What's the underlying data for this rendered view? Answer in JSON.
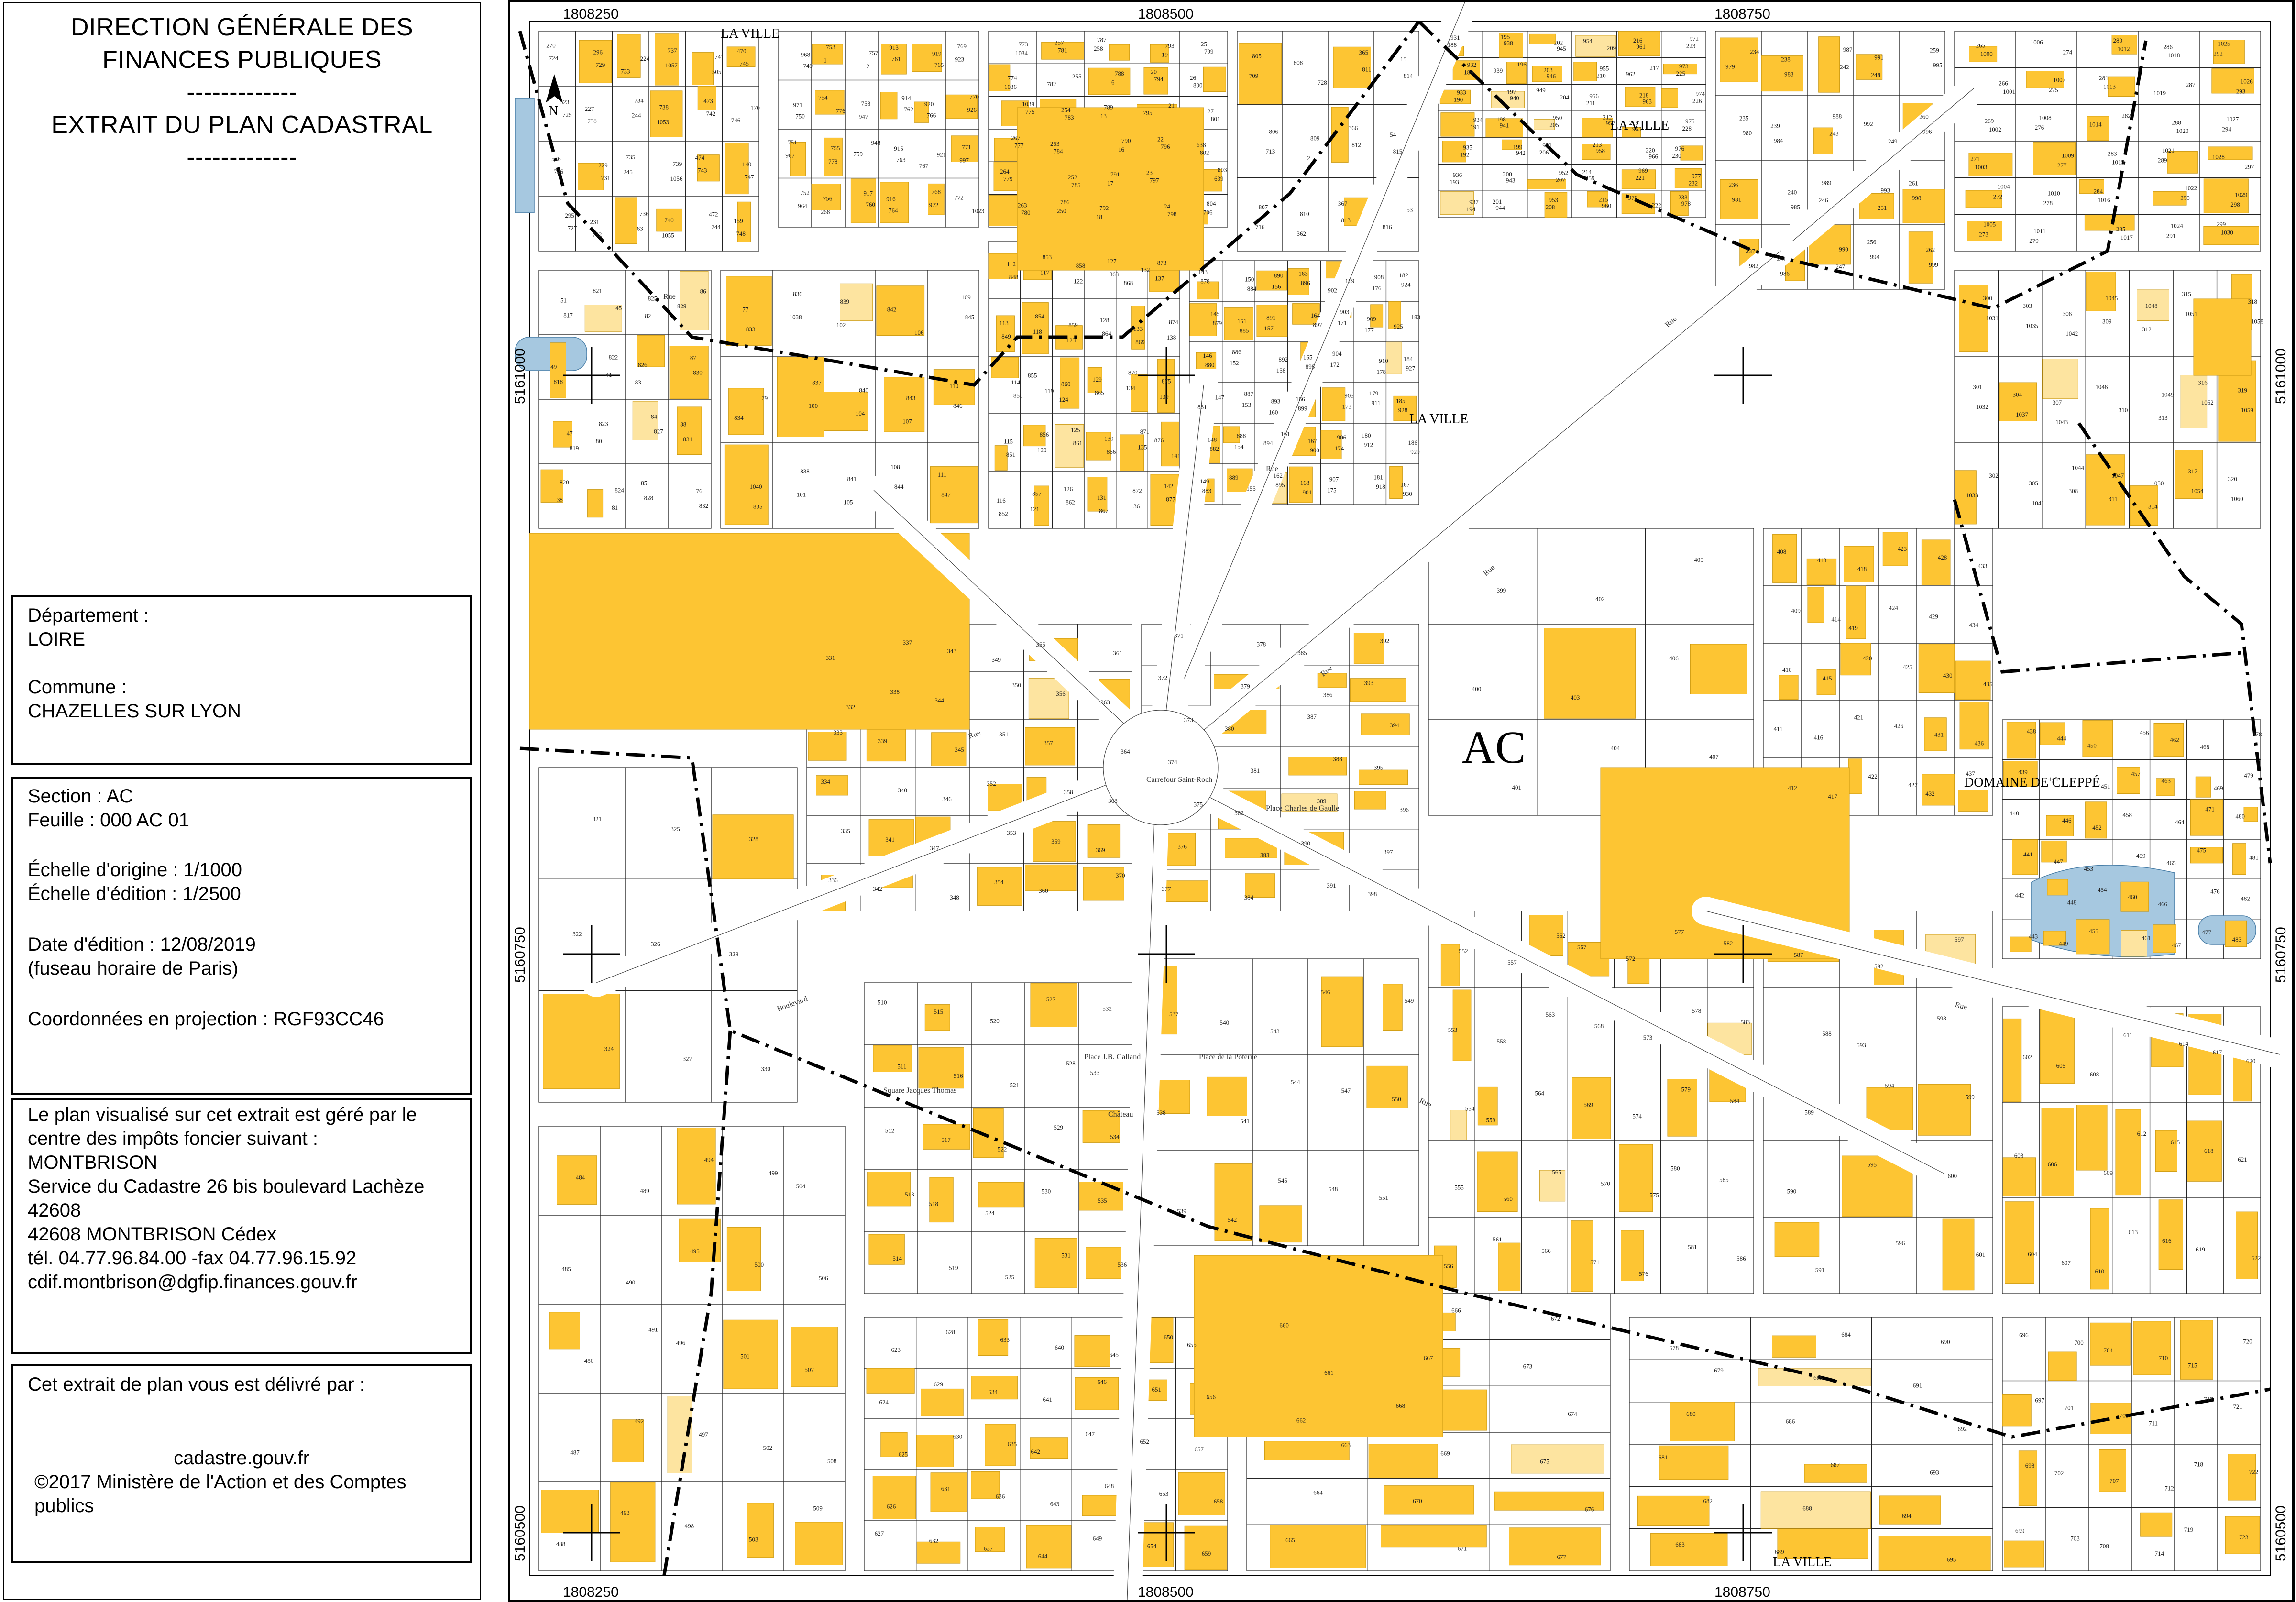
{
  "header": {
    "line1": "DIRECTION GÉNÉRALE DES",
    "line2": "FINANCES PUBLIQUES",
    "sep1": "-------------",
    "line3": "EXTRAIT DU PLAN CADASTRAL",
    "sep2": "-------------"
  },
  "location": {
    "departement_label": "Département :",
    "departement": "LOIRE",
    "commune_label": "Commune :",
    "commune": "CHAZELLES SUR LYON"
  },
  "section_info": {
    "section": "Section : AC",
    "feuille": "Feuille : 000 AC 01",
    "echelle_origine": "Échelle d'origine : 1/1000",
    "echelle_edition": "Échelle d'édition : 1/2500",
    "date_edition": "Date d'édition : 12/08/2019",
    "fuseau": "(fuseau horaire de Paris)",
    "projection": "Coordonnées en projection : RGF93CC46"
  },
  "service": {
    "intro1": "Le plan visualisé sur cet extrait est géré par le",
    "intro2": "centre des impôts foncier suivant :",
    "name": "MONTBRISON",
    "address": "Service du Cadastre 26 bis boulevard Lachèze",
    "postcode": "42608",
    "city": "42608 MONTBRISON Cédex",
    "phone": "tél. 04.77.96.84.00 -fax 04.77.96.15.92",
    "email": "cdif.montbrison@dgfip.finances.gouv.fr"
  },
  "delivery": {
    "label": "Cet extrait de plan vous est délivré par :",
    "site": "cadastre.gouv.fr",
    "copyright1": "©2017 Ministère de l'Action et des Comptes",
    "copyright2": "publics"
  },
  "map": {
    "colors": {
      "building": "#fdc533",
      "building_light": "#fde4a0",
      "water": "#a6c8e0",
      "line": "#222222"
    },
    "coords": {
      "x_top": [
        "1808250",
        "1808500",
        "1808750"
      ],
      "x_bottom": [
        "1808250",
        "1808500",
        "1808750"
      ],
      "y_left": [
        "5161000",
        "5160750",
        "5160500"
      ],
      "y_right": [
        "5161000",
        "5160750",
        "5160500"
      ]
    },
    "north_symbol": "N",
    "section_label": "AC",
    "places": [
      "LA VILLE",
      "LA VILLE",
      "LA VILLE",
      "LA VILLE",
      "DOMAINE DE CLEPPÉ"
    ],
    "small_places": [
      "Place J.B. Galland",
      "Place de la Poterne",
      "Place Charles de Gaulle",
      "Carrefour Saint-Roch",
      "Square Jacques Thomas",
      "Château"
    ],
    "streets": [
      "Rue",
      "Boulevard",
      "Rue",
      "Rue",
      "Rue",
      "Rue",
      "Rue",
      "Rue",
      "Rue"
    ],
    "parcels": [
      "270",
      "523",
      "526",
      "295",
      "296",
      "227",
      "229",
      "231",
      "224",
      "244",
      "245",
      "63",
      "1057",
      "1053",
      "1056",
      "1055",
      "505",
      "473",
      "474",
      "472",
      "470",
      "170",
      "140",
      "159",
      "968",
      "971",
      "967",
      "964",
      "1",
      "776",
      "778",
      "268",
      "2",
      "947",
      "948",
      "917",
      "913",
      "914",
      "915",
      "916",
      "919",
      "920",
      "921",
      "922",
      "923",
      "926",
      "997",
      "1023",
      "1034",
      "1036",
      "1039",
      "267",
      "264",
      "263",
      "257",
      "255",
      "254",
      "253",
      "252",
      "250",
      "258",
      "6",
      "13",
      "16",
      "17",
      "18",
      "19",
      "20",
      "21",
      "22",
      "23",
      "24",
      "25",
      "26",
      "27",
      "638",
      "639",
      "706",
      "709",
      "713",
      "716",
      "728",
      "2",
      "362",
      "365",
      "366",
      "367",
      "15",
      "54",
      "53",
      "51",
      "49",
      "47",
      "38",
      "45",
      "41",
      "80",
      "81",
      "82",
      "83",
      "84",
      "85",
      "86",
      "87",
      "88",
      "76",
      "77",
      "79",
      "1040",
      "1038",
      "100",
      "101",
      "102",
      "104",
      "105",
      "106",
      "107",
      "108",
      "109",
      "110",
      "111",
      "112",
      "113",
      "114",
      "115",
      "116",
      "117",
      "118",
      "119",
      "120",
      "121",
      "122",
      "123",
      "124",
      "125",
      "126",
      "127",
      "128",
      "129",
      "130",
      "131",
      "132",
      "133",
      "134",
      "135",
      "136",
      "137",
      "138",
      "139",
      "141",
      "142",
      "143",
      "145",
      "146",
      "147",
      "148",
      "149",
      "150",
      "151",
      "152",
      "153",
      "154",
      "155",
      "156",
      "157",
      "158",
      "160",
      "161",
      "162",
      "163",
      "164",
      "165",
      "166",
      "167",
      "168",
      "169",
      "171",
      "172",
      "173",
      "174",
      "175",
      "176",
      "177",
      "178",
      "179",
      "180",
      "181",
      "182",
      "183",
      "184",
      "185",
      "186",
      "187",
      "188",
      "189",
      "190",
      "191",
      "192",
      "193",
      "194",
      "195",
      "196",
      "197",
      "198",
      "199",
      "200",
      "201",
      "202",
      "203",
      "204",
      "205",
      "206",
      "207",
      "208",
      "209",
      "210",
      "211",
      "212",
      "213",
      "214",
      "215",
      "216",
      "217",
      "218",
      "219",
      "220",
      "221",
      "222",
      "223",
      "225",
      "226",
      "228",
      "230",
      "232",
      "233",
      "234",
      "235",
      "236",
      "237",
      "238",
      "239",
      "240",
      "241",
      "242",
      "243",
      "246",
      "247",
      "248",
      "249",
      "251",
      "256",
      "259",
      "260",
      "261",
      "262",
      "265",
      "266",
      "269",
      "271",
      "272",
      "273",
      "274",
      "275",
      "276",
      "277",
      "278",
      "279",
      "280",
      "281",
      "282",
      "283",
      "284",
      "285",
      "286",
      "287",
      "288",
      "289",
      "290",
      "291",
      "292",
      "293",
      "294",
      "297",
      "298",
      "299",
      "300",
      "301",
      "302",
      "303",
      "304",
      "305",
      "306",
      "307",
      "308",
      "309",
      "310",
      "311",
      "312",
      "313",
      "314",
      "315",
      "316",
      "317",
      "318",
      "319",
      "320",
      "321",
      "322",
      "324",
      "325",
      "326",
      "327",
      "328",
      "329",
      "330",
      "331",
      "332",
      "333",
      "334",
      "335",
      "336",
      "337",
      "338",
      "339",
      "340",
      "341",
      "342",
      "343",
      "344",
      "345",
      "346",
      "347",
      "348",
      "349",
      "350",
      "351",
      "352",
      "353",
      "354",
      "355",
      "356",
      "357",
      "358",
      "359",
      "360",
      "361",
      "363",
      "364",
      "368",
      "369",
      "370",
      "371",
      "372",
      "373",
      "374",
      "375",
      "376",
      "377",
      "378",
      "379",
      "380",
      "381",
      "382",
      "383",
      "384",
      "385",
      "386",
      "387",
      "388",
      "389",
      "390",
      "391",
      "392",
      "393",
      "394",
      "395",
      "396",
      "397",
      "398",
      "399",
      "400",
      "401",
      "402",
      "403",
      "404",
      "405",
      "406",
      "407",
      "408",
      "409",
      "410",
      "411",
      "412",
      "413",
      "414",
      "415",
      "416",
      "417",
      "418",
      "419",
      "420",
      "421",
      "422",
      "423",
      "424",
      "425",
      "426",
      "427",
      "428",
      "429",
      "430",
      "431",
      "432",
      "433",
      "434",
      "435",
      "436",
      "437",
      "438",
      "439",
      "440",
      "441",
      "442",
      "443",
      "444",
      "445",
      "446",
      "447",
      "448",
      "449",
      "450",
      "451",
      "452",
      "453",
      "454",
      "455",
      "456",
      "457",
      "458",
      "459",
      "460",
      "461",
      "462",
      "463",
      "464",
      "465",
      "466",
      "467",
      "468",
      "469",
      "471",
      "475",
      "476",
      "477",
      "478",
      "479",
      "480",
      "481",
      "482",
      "483",
      "484",
      "485",
      "486",
      "487",
      "488",
      "489",
      "490",
      "491",
      "492",
      "493",
      "494",
      "495",
      "496",
      "497",
      "498",
      "499",
      "500",
      "501",
      "502",
      "503",
      "504",
      "506",
      "507",
      "508",
      "509",
      "510"
    ],
    "parcels_b": [
      "511",
      "512",
      "513",
      "514",
      "515",
      "516",
      "517",
      "518",
      "519",
      "520",
      "521",
      "522",
      "524",
      "525",
      "527",
      "528",
      "529",
      "530",
      "531",
      "532",
      "533",
      "534",
      "535",
      "536",
      "537",
      "538",
      "539",
      "540",
      "541",
      "542",
      "543",
      "544",
      "545",
      "546",
      "547",
      "548",
      "549",
      "550",
      "551",
      "552",
      "553",
      "554",
      "555",
      "556",
      "557",
      "558",
      "559",
      "560",
      "561",
      "562",
      "563",
      "564",
      "565",
      "566",
      "567",
      "568",
      "569",
      "570",
      "571",
      "572",
      "573",
      "574",
      "575",
      "576",
      "577",
      "578",
      "579",
      "580",
      "581",
      "582",
      "583",
      "584",
      "585",
      "586",
      "587",
      "588",
      "589",
      "590",
      "591",
      "592",
      "593",
      "594",
      "595",
      "596",
      "597",
      "598",
      "599",
      "600",
      "601",
      "602",
      "603",
      "604",
      "605",
      "606",
      "607",
      "608",
      "609",
      "610",
      "611",
      "612",
      "613",
      "614",
      "615",
      "616",
      "617",
      "618",
      "619",
      "620",
      "621",
      "622",
      "623",
      "624",
      "625",
      "626",
      "627",
      "628",
      "629",
      "630",
      "631",
      "632",
      "633",
      "634",
      "635",
      "636",
      "637",
      "640",
      "641",
      "642",
      "643",
      "644",
      "645",
      "646",
      "647",
      "648",
      "649",
      "650",
      "651",
      "652",
      "653",
      "654",
      "655",
      "656",
      "657",
      "658",
      "659",
      "660",
      "661",
      "662",
      "663",
      "664",
      "665",
      "666",
      "667",
      "668",
      "669",
      "670",
      "671",
      "672",
      "673",
      "674",
      "675",
      "676",
      "677",
      "678",
      "679",
      "680",
      "681",
      "682",
      "683",
      "684",
      "685",
      "686",
      "687",
      "688",
      "689",
      "690",
      "691",
      "692",
      "693",
      "694",
      "695",
      "696",
      "697",
      "698",
      "699",
      "700",
      "701",
      "702",
      "703",
      "704",
      "705",
      "707",
      "708",
      "710",
      "711",
      "712",
      "714",
      "715",
      "717",
      "718",
      "719",
      "720",
      "721",
      "722",
      "723",
      "724",
      "725",
      "726",
      "727",
      "729",
      "730",
      "731",
      "732",
      "733",
      "734",
      "735",
      "736",
      "737",
      "738",
      "739",
      "740",
      "741",
      "742",
      "743",
      "744",
      "745",
      "746",
      "747",
      "748",
      "749",
      "750",
      "751",
      "752",
      "753",
      "754",
      "755",
      "756",
      "757",
      "758",
      "759",
      "760",
      "761",
      "762",
      "763",
      "764",
      "765",
      "766",
      "767",
      "768",
      "769",
      "770",
      "771",
      "772",
      "773",
      "774",
      "775",
      "777",
      "779",
      "780",
      "781",
      "782",
      "783",
      "784",
      "785",
      "786",
      "787",
      "788",
      "789",
      "790",
      "791",
      "792",
      "793",
      "794",
      "795",
      "796",
      "797",
      "798",
      "799",
      "800",
      "801",
      "802",
      "803",
      "804",
      "805",
      "806",
      "807",
      "808",
      "809",
      "810",
      "811",
      "812",
      "813",
      "814",
      "815",
      "816",
      "817",
      "818",
      "819",
      "820",
      "821",
      "822",
      "823",
      "824",
      "825",
      "826",
      "827",
      "828",
      "829",
      "830",
      "831",
      "832",
      "833",
      "834",
      "835",
      "836",
      "837",
      "838",
      "839",
      "840",
      "841",
      "842",
      "843",
      "844",
      "845",
      "846",
      "847",
      "848",
      "849",
      "850",
      "851",
      "852",
      "853",
      "854",
      "855",
      "856",
      "857",
      "858",
      "859",
      "860",
      "861",
      "862",
      "863",
      "864",
      "865",
      "866",
      "867",
      "868",
      "869",
      "870",
      "871",
      "872",
      "873",
      "874",
      "875",
      "876",
      "877",
      "878",
      "879",
      "880",
      "881",
      "882",
      "883",
      "884",
      "885",
      "886",
      "887",
      "888",
      "889",
      "890",
      "891",
      "892",
      "893",
      "894",
      "895",
      "896",
      "897",
      "898",
      "899",
      "900",
      "901",
      "902",
      "903",
      "904",
      "905",
      "906",
      "907",
      "908",
      "909",
      "910",
      "911",
      "912",
      "918",
      "924",
      "925",
      "927",
      "928",
      "929",
      "930",
      "931",
      "932",
      "933",
      "934",
      "935",
      "936",
      "937",
      "938",
      "939",
      "940",
      "941",
      "942",
      "943",
      "944",
      "945",
      "946",
      "949",
      "950",
      "951",
      "952",
      "953",
      "954",
      "955",
      "956",
      "957",
      "958",
      "959",
      "960",
      "961",
      "962",
      "963",
      "965",
      "966",
      "969",
      "970",
      "972",
      "973",
      "974",
      "975",
      "976",
      "977",
      "978",
      "979",
      "980",
      "981",
      "982",
      "983",
      "984",
      "985",
      "986",
      "987",
      "988",
      "989",
      "990",
      "991",
      "992",
      "993",
      "994",
      "995",
      "996",
      "998",
      "999",
      "1000",
      "1001",
      "1002",
      "1003",
      "1004",
      "1005",
      "1006",
      "1007",
      "1008",
      "1009",
      "1010",
      "1011",
      "1012",
      "1013",
      "1014",
      "1015",
      "1016",
      "1017",
      "1018",
      "1019",
      "1020",
      "1021",
      "1022",
      "1024",
      "1025",
      "1026",
      "1027",
      "1028",
      "1029",
      "1030",
      "1031",
      "1032",
      "1033",
      "1035",
      "1037",
      "1041",
      "1042",
      "1043",
      "1044",
      "1045",
      "1046",
      "1047",
      "1048",
      "1049",
      "1050",
      "1051",
      "1052",
      "1054",
      "1058",
      "1059",
      "1060"
    ]
  }
}
